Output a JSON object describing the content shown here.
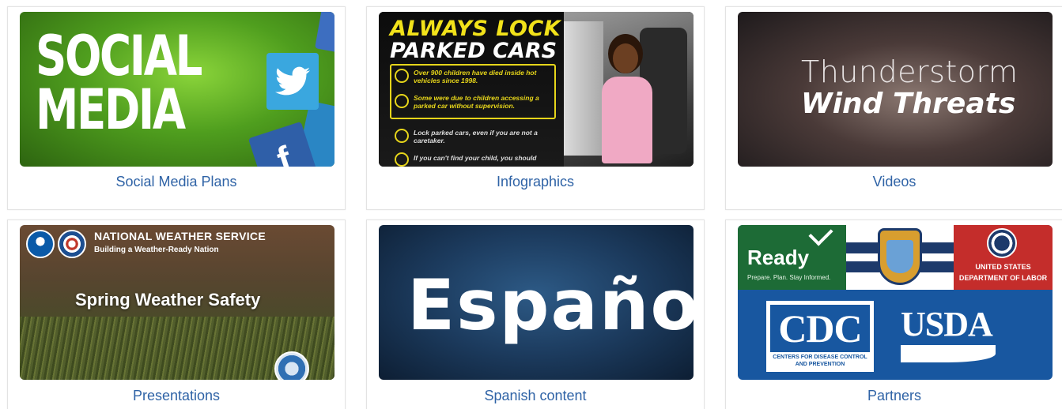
{
  "cards": [
    {
      "caption": "Social Media Plans",
      "thumb": {
        "line1": "SOCIAL",
        "line2": "MEDIA",
        "fb_glyph": "f"
      }
    },
    {
      "caption": "Infographics",
      "thumb": {
        "heading1": "ALWAYS LOCK",
        "heading2": "PARKED CARS",
        "points": [
          "Over 900 children have died inside hot vehicles since 1998.",
          "Some were due to children accessing a parked car without supervision.",
          "Lock parked cars, even if you are not a caretaker.",
          "If you can't find your child, you should"
        ]
      }
    },
    {
      "caption": "Videos",
      "thumb": {
        "line1": "Thunderstorm",
        "line2": "Wind Threats"
      }
    },
    {
      "caption": "Presentations",
      "thumb": {
        "org": "NATIONAL WEATHER SERVICE",
        "tagline": "Building a Weather-Ready Nation",
        "title": "Spring Weather Safety"
      }
    },
    {
      "caption": "Spanish content",
      "thumb": {
        "text": "Español"
      }
    },
    {
      "caption": "Partners",
      "thumb": {
        "ready": "Ready",
        "ready_sub": "Prepare. Plan. Stay Informed.",
        "dol_line1": "UNITED STATES",
        "dol_line2": "DEPARTMENT OF LABOR",
        "cdc": "CDC",
        "cdc_sub": "CENTERS FOR DISEASE CONTROL AND PREVENTION",
        "usda": "USDA"
      }
    }
  ],
  "colors": {
    "caption_link": "#2f63a6",
    "card_border": "#e3e3e3"
  }
}
